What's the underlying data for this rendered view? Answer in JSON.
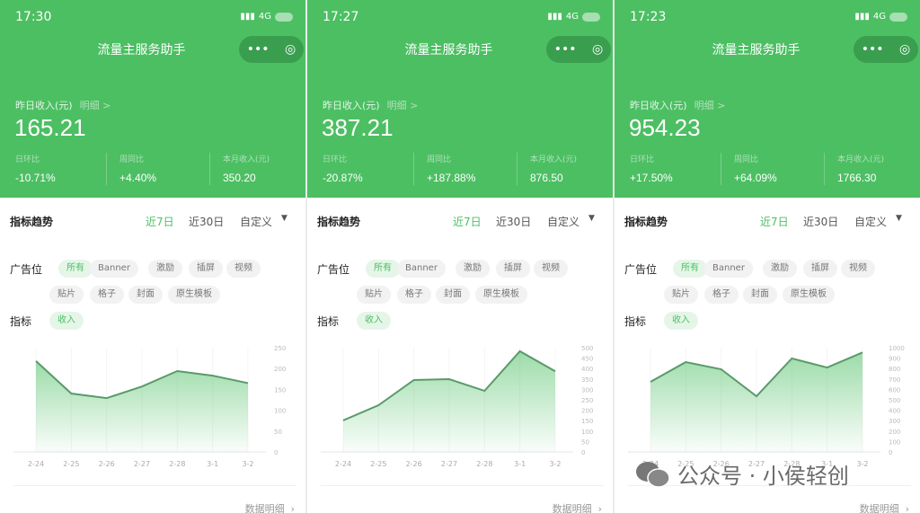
{
  "accent": "#4cbf63",
  "panels": [
    {
      "time": "17:30",
      "network": "4G",
      "app_title": "流量主服务助手",
      "income_label": "昨日收入(元)",
      "detail_link": "明细 >",
      "income": "165.21",
      "stats": [
        {
          "label": "日环比",
          "value": "-10.71%"
        },
        {
          "label": "周同比",
          "value": "+4.40%"
        },
        {
          "label": "本月收入(元)",
          "value": "350.20"
        }
      ],
      "section_title": "指标趋势",
      "ranges": [
        "近7日",
        "近30日",
        "自定义"
      ],
      "active_range": 0,
      "ad_label": "广告位",
      "ad_chips": [
        "所有",
        "Banner",
        "激励",
        "插屏",
        "视频",
        "贴片",
        "格子",
        "封面",
        "原生模板"
      ],
      "metric_label": "指标",
      "metric_chip": "收入",
      "detail_footer": "数据明细",
      "chart_data": {
        "type": "area",
        "categories": [
          "2-24",
          "2-25",
          "2-26",
          "2-27",
          "2-28",
          "3-1",
          "3-2"
        ],
        "values": [
          218,
          140,
          129,
          157,
          194,
          183,
          165
        ],
        "ylim": [
          0,
          250
        ],
        "yticks": [
          "0",
          "50",
          "100",
          "150",
          "200",
          "250"
        ],
        "grid": true
      }
    },
    {
      "time": "17:27",
      "network": "4G",
      "app_title": "流量主服务助手",
      "income_label": "昨日收入(元)",
      "detail_link": "明细 >",
      "income": "387.21",
      "stats": [
        {
          "label": "日环比",
          "value": "-20.87%"
        },
        {
          "label": "周同比",
          "value": "+187.88%"
        },
        {
          "label": "本月收入(元)",
          "value": "876.50"
        }
      ],
      "section_title": "指标趋势",
      "ranges": [
        "近7日",
        "近30日",
        "自定义"
      ],
      "active_range": 0,
      "ad_label": "广告位",
      "ad_chips": [
        "所有",
        "Banner",
        "激励",
        "插屏",
        "视频",
        "贴片",
        "格子",
        "封面",
        "原生模板"
      ],
      "metric_label": "指标",
      "metric_chip": "收入",
      "detail_footer": "数据明细",
      "chart_data": {
        "type": "area",
        "categories": [
          "2-24",
          "2-25",
          "2-26",
          "2-27",
          "2-28",
          "3-1",
          "3-2"
        ],
        "values": [
          151,
          224,
          345,
          349,
          293,
          483,
          387
        ],
        "ylim": [
          0,
          500
        ],
        "yticks": [
          "0",
          "50",
          "100",
          "150",
          "200",
          "250",
          "300",
          "350",
          "400",
          "450",
          "500"
        ],
        "grid": true
      }
    },
    {
      "time": "17:23",
      "network": "4G",
      "app_title": "流量主服务助手",
      "income_label": "昨日收入(元)",
      "detail_link": "明细 >",
      "income": "954.23",
      "stats": [
        {
          "label": "日环比",
          "value": "+17.50%"
        },
        {
          "label": "周同比",
          "value": "+64.09%"
        },
        {
          "label": "本月收入(元)",
          "value": "1766.30"
        }
      ],
      "section_title": "指标趋势",
      "ranges": [
        "近7日",
        "近30日",
        "自定义"
      ],
      "active_range": 0,
      "ad_label": "广告位",
      "ad_chips": [
        "所有",
        "Banner",
        "激励",
        "插屏",
        "视频",
        "贴片",
        "格子",
        "封面",
        "原生模板"
      ],
      "metric_label": "指标",
      "metric_chip": "收入",
      "detail_footer": "数据明细",
      "chart_data": {
        "type": "area",
        "categories": [
          "2-24",
          "2-25",
          "2-26",
          "2-27",
          "2-28",
          "3-1",
          "3-2"
        ],
        "values": [
          672,
          862,
          793,
          534,
          897,
          810,
          954
        ],
        "ylim": [
          0,
          1000
        ],
        "yticks": [
          "0",
          "100",
          "200",
          "300",
          "400",
          "500",
          "600",
          "700",
          "800",
          "900",
          "1000"
        ],
        "grid": true
      }
    }
  ],
  "watermark": "公众号 · 小侯轻创"
}
